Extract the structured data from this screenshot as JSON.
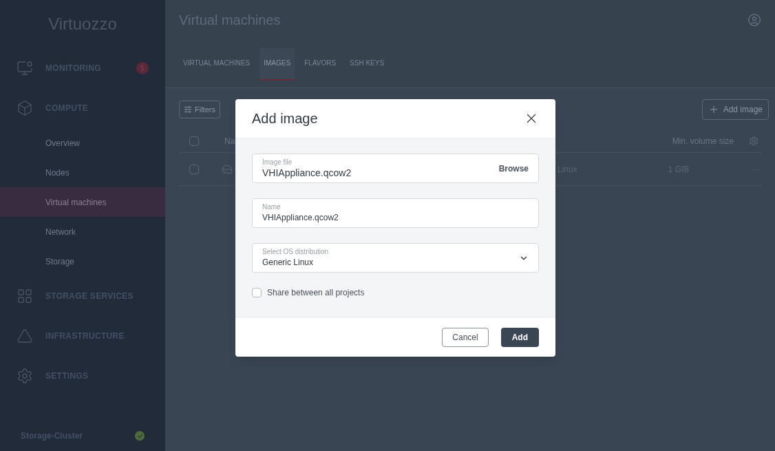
{
  "sidebar": {
    "logo": "Virtuozzo",
    "items": [
      {
        "kind": "section",
        "label": "MONITORING",
        "badge": "5",
        "selected": false
      },
      {
        "kind": "section",
        "label": "COMPUTE",
        "selected": false
      },
      {
        "kind": "sub",
        "label": "Overview",
        "selected": false
      },
      {
        "kind": "sub",
        "label": "Nodes",
        "selected": false
      },
      {
        "kind": "sub",
        "label": "Virtual machines",
        "selected": true
      },
      {
        "kind": "sub",
        "label": "Network",
        "selected": false
      },
      {
        "kind": "sub",
        "label": "Storage",
        "selected": false
      },
      {
        "kind": "section",
        "label": "STORAGE SERVICES",
        "selected": false
      },
      {
        "kind": "section",
        "label": "INFRASTRUCTURE",
        "selected": false
      },
      {
        "kind": "section",
        "label": "SETTINGS",
        "selected": false
      }
    ],
    "cluster": {
      "name": "Storage-Cluster",
      "color": "#4f6a3c"
    }
  },
  "page": {
    "title": "Virtual machines",
    "tabs": [
      {
        "label": "VIRTUAL MACHINES",
        "selected": false
      },
      {
        "label": "IMAGES",
        "selected": true
      },
      {
        "label": "FLAVORS",
        "selected": false
      },
      {
        "label": "SSH KEYS",
        "selected": false
      }
    ],
    "filters_button": "Filters",
    "add_button": "Add image",
    "table": {
      "select_all": false,
      "columns": [
        "Na",
        "Min. volume size"
      ],
      "rows": [
        {
          "checked": false,
          "column_3": "Linux",
          "size": "1 GIB",
          "menu": "···"
        }
      ]
    }
  },
  "dialog": {
    "title": "Add image",
    "fields": [
      {
        "kind": "file",
        "label": "Image file",
        "value": "VHIAppliance.qcow2",
        "action": "Browse"
      },
      {
        "kind": "text",
        "label": "Name",
        "value": "VHIAppliance.qcow2"
      },
      {
        "kind": "select",
        "label": "Select OS distribution",
        "value": "Generic Linux"
      }
    ],
    "share": {
      "label": "Share between all projects",
      "checked": false
    },
    "buttons": [
      {
        "kind": "secondary",
        "label": "Cancel"
      },
      {
        "kind": "primary",
        "label": "Add"
      }
    ]
  }
}
